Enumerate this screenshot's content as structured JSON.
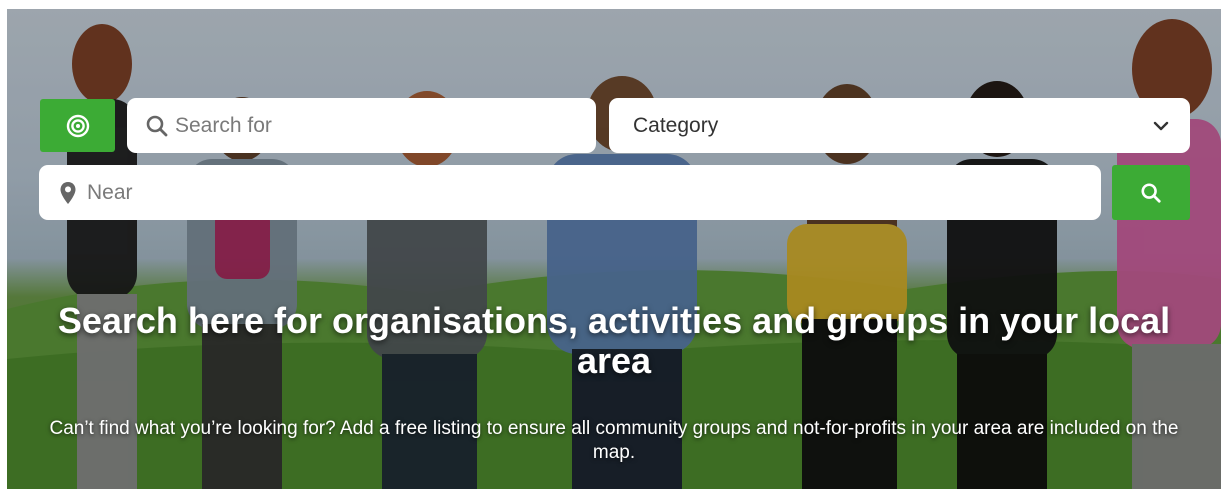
{
  "search": {
    "placeholder": "Search for",
    "category_label": "Category",
    "near_placeholder": "Near"
  },
  "hero": {
    "headline": "Search here for organisations, activities and groups in your local area",
    "subline": "Can’t find what you’re looking for? Add a free listing to ensure all community groups and not-for-profits in your area are included on the map."
  },
  "icons": {
    "locate": "target-icon",
    "search": "search-icon",
    "category_arrow": "chevron-down-icon",
    "near": "map-pin-icon",
    "submit": "search-icon"
  },
  "colors": {
    "accent": "#3cab35",
    "text": "#ffffff"
  }
}
